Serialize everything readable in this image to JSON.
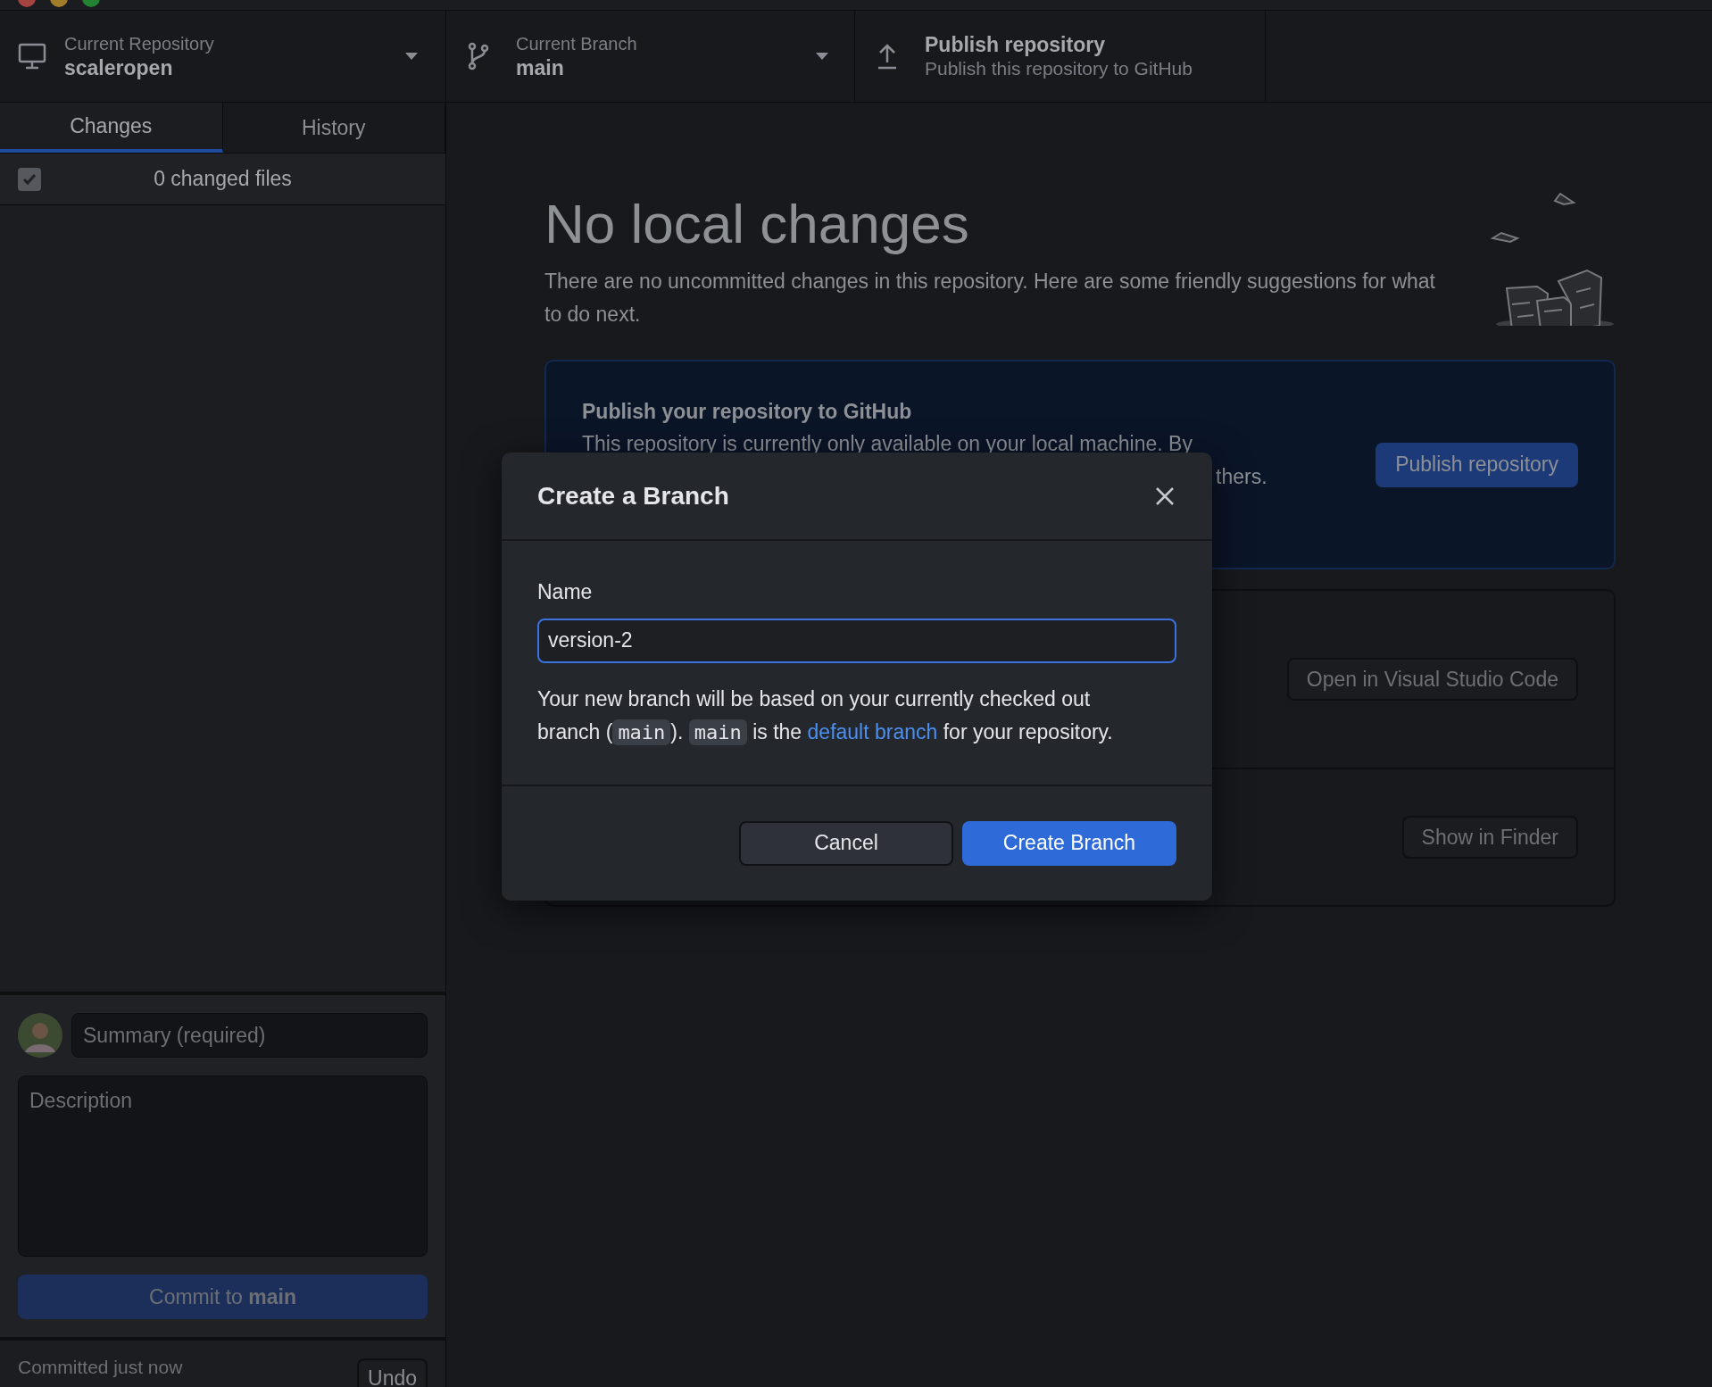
{
  "toolbar": {
    "repository": {
      "label": "Current Repository",
      "value": "scaleropen"
    },
    "branch": {
      "label": "Current Branch",
      "value": "main"
    },
    "publish": {
      "title": "Publish repository",
      "subtitle": "Publish this repository to GitHub"
    }
  },
  "sidebar": {
    "tabs": [
      {
        "label": "Changes",
        "selected": true
      },
      {
        "label": "History",
        "selected": false
      }
    ],
    "select_all": {
      "checked": true,
      "label": "0 changed files"
    },
    "commit": {
      "summary_placeholder": "Summary (required)",
      "description_placeholder": "Description",
      "button": "Commit to **main**",
      "disabled": true
    },
    "last_commit": {
      "text": "Committed just now",
      "undo": "Undo"
    }
  },
  "main": {
    "title": "No local changes",
    "description": "There are no uncommitted changes in this repository. Here are some friendly suggestions for what to do next.",
    "publish_card": {
      "title": "Publish your repository to GitHub",
      "line_1": "This repository is currently only available on your local machine. By",
      "line_2_tail": "thers.",
      "button": "Publish repository"
    },
    "actions": [
      {
        "button": "Open in Visual Studio Code"
      },
      {
        "button": "Show in Finder"
      }
    ]
  },
  "dialog": {
    "title": "Create a Branch",
    "name_label": "Name",
    "name_value": "version-2",
    "note": [
      {
        "kind": "text",
        "text": "Your new branch will be based on your currently checked out branch ("
      },
      {
        "kind": "code",
        "text": "main"
      },
      {
        "kind": "text",
        "text": "). "
      },
      {
        "kind": "code",
        "text": "main"
      },
      {
        "kind": "text",
        "text": " is the "
      },
      {
        "kind": "link",
        "text": "default branch"
      },
      {
        "kind": "text",
        "text": " for your repository."
      }
    ],
    "buttons": [
      {
        "label": "Cancel",
        "kind": "secondary"
      },
      {
        "label": "Create Branch",
        "kind": "primary"
      }
    ]
  }
}
